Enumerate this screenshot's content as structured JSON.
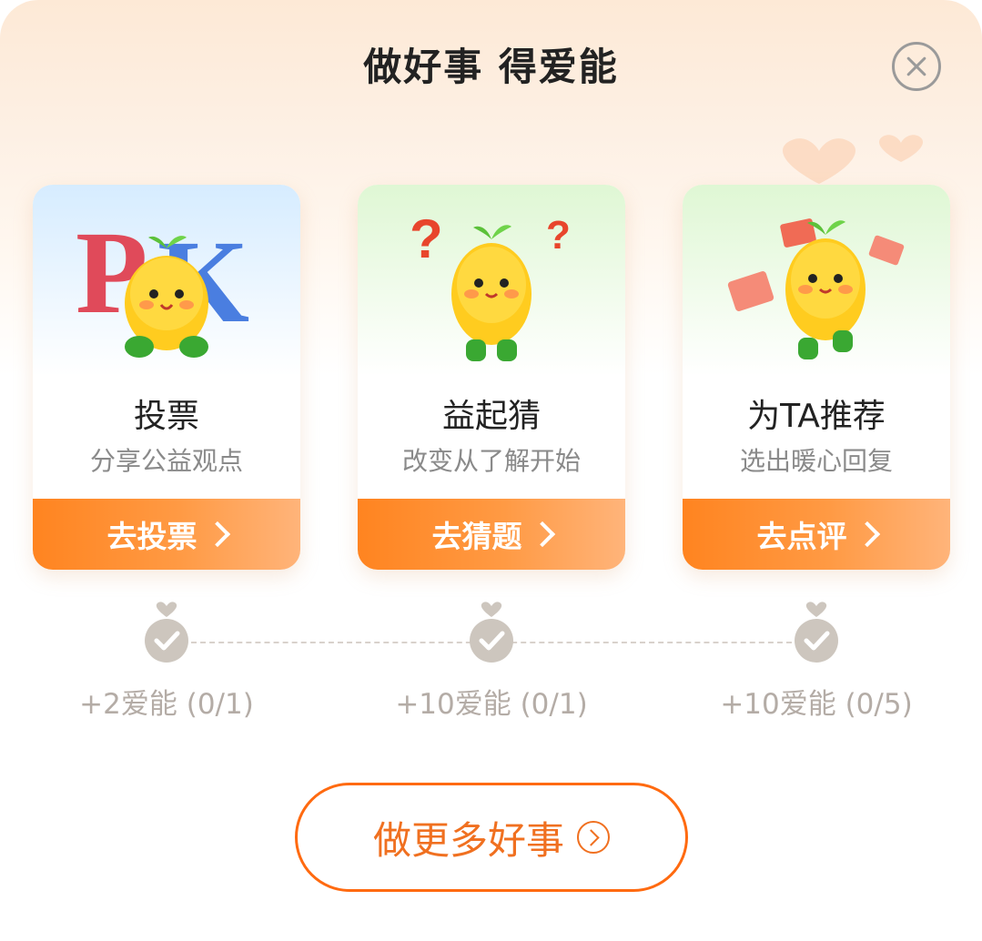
{
  "header": {
    "title": "做好事 得爱能"
  },
  "tasks": [
    {
      "name": "投票",
      "desc": "分享公益观点",
      "action": "去投票",
      "reward": "+2爱能 (0/1)",
      "art": "pk-mascot-icon"
    },
    {
      "name": "益起猜",
      "desc": "改变从了解开始",
      "action": "去猜题",
      "reward": "+10爱能 (0/1)",
      "art": "question-mascot-icon"
    },
    {
      "name": "为TA推荐",
      "desc": "选出暖心回复",
      "action": "去点评",
      "reward": "+10爱能 (0/5)",
      "art": "envelope-mascot-icon"
    }
  ],
  "footer": {
    "more_label": "做更多好事"
  },
  "colors": {
    "accent": "#ff8420",
    "outline": "#ff6a10",
    "muted": "#b4aca6"
  }
}
